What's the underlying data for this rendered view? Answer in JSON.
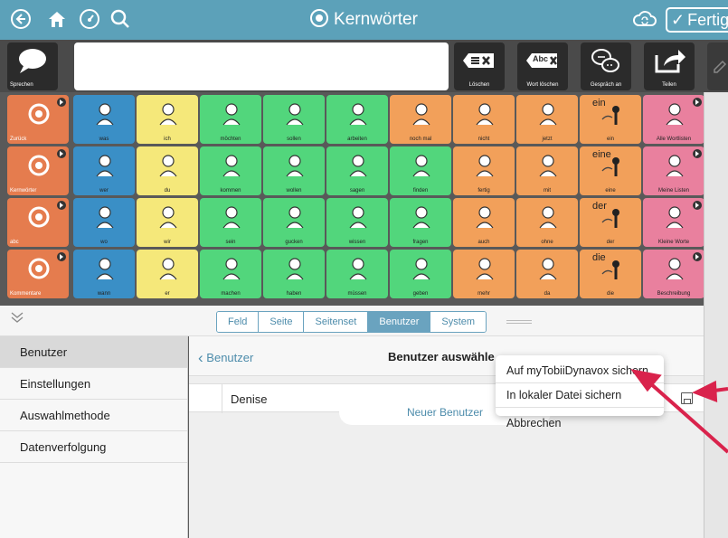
{
  "topbar": {
    "title": "Kernwörter",
    "done_label": "Fertig",
    "icons": [
      "back-circle-icon",
      "home-icon",
      "dashboard-icon",
      "search-icon",
      "cloud-sync-icon"
    ]
  },
  "message_bar": {
    "speak_label": "Sprechen",
    "delete_label": "Löschen",
    "delete_word_label": "Wort löschen",
    "conversation_label": "Gespräch an",
    "share_label": "Teilen",
    "delete_word_icon_text": "Abc",
    "conversation_icon": "speech-bubbles-icon"
  },
  "grid": {
    "cells": [
      {
        "label": "Zurück",
        "color": "#e57c4e",
        "dark": true,
        "icon": "back-arrow-icon"
      },
      {
        "label": "was",
        "color": "#3a8fc6",
        "dark": false,
        "icon": "was-symbol-icon"
      },
      {
        "label": "ich",
        "color": "#f5e87a",
        "dark": false,
        "icon": "ich-symbol-icon"
      },
      {
        "label": "möchten",
        "color": "#52d67c",
        "dark": false,
        "icon": "moechten-symbol-icon"
      },
      {
        "label": "sollen",
        "color": "#52d67c",
        "dark": false,
        "icon": "sollen-symbol-icon"
      },
      {
        "label": "arbeiten",
        "color": "#52d67c",
        "dark": false,
        "icon": "arbeiten-symbol-icon"
      },
      {
        "label": "noch mal",
        "color": "#f2a05a",
        "dark": false,
        "icon": "noch-mal-symbol-icon"
      },
      {
        "label": "nicht",
        "color": "#f2a05a",
        "dark": false,
        "icon": "nicht-symbol-icon"
      },
      {
        "label": "jetzt",
        "color": "#f2a05a",
        "dark": false,
        "icon": "jetzt-symbol-icon"
      },
      {
        "label": "ein",
        "color": "#f2a05a",
        "dark": false,
        "icon": "ein-symbol-icon",
        "word": "ein"
      },
      {
        "label": "Alle Wortlisten",
        "color": "#e9809e",
        "dark": false,
        "icon": "wortlisten-symbol-icon"
      },
      {
        "label": "Kernwörter",
        "color": "#e57c4e",
        "dark": true,
        "icon": "kernwoerter-target-icon"
      },
      {
        "label": "wer",
        "color": "#3a8fc6",
        "dark": false,
        "icon": "wer-symbol-icon"
      },
      {
        "label": "du",
        "color": "#f5e87a",
        "dark": false,
        "icon": "du-symbol-icon"
      },
      {
        "label": "kommen",
        "color": "#52d67c",
        "dark": false,
        "icon": "kommen-symbol-icon"
      },
      {
        "label": "wollen",
        "color": "#52d67c",
        "dark": false,
        "icon": "wollen-symbol-icon"
      },
      {
        "label": "sagen",
        "color": "#52d67c",
        "dark": false,
        "icon": "sagen-symbol-icon"
      },
      {
        "label": "finden",
        "color": "#52d67c",
        "dark": false,
        "icon": "finden-symbol-icon"
      },
      {
        "label": "fertig",
        "color": "#f2a05a",
        "dark": false,
        "icon": "fertig-symbol-icon"
      },
      {
        "label": "mit",
        "color": "#f2a05a",
        "dark": false,
        "icon": "mit-symbol-icon"
      },
      {
        "label": "eine",
        "color": "#f2a05a",
        "dark": false,
        "icon": "eine-symbol-icon",
        "word": "eine"
      },
      {
        "label": "Meine Listen",
        "color": "#e9809e",
        "dark": false,
        "icon": "meine-listen-symbol-icon"
      },
      {
        "label": "abc",
        "color": "#e57c4e",
        "dark": true,
        "icon": "abc-keyboard-icon"
      },
      {
        "label": "wo",
        "color": "#3a8fc6",
        "dark": false,
        "icon": "wo-symbol-icon"
      },
      {
        "label": "wir",
        "color": "#f5e87a",
        "dark": false,
        "icon": "wir-symbol-icon"
      },
      {
        "label": "sein",
        "color": "#52d67c",
        "dark": false,
        "icon": "sein-symbol-icon"
      },
      {
        "label": "gucken",
        "color": "#52d67c",
        "dark": false,
        "icon": "gucken-symbol-icon"
      },
      {
        "label": "wissen",
        "color": "#52d67c",
        "dark": false,
        "icon": "wissen-symbol-icon"
      },
      {
        "label": "fragen",
        "color": "#52d67c",
        "dark": false,
        "icon": "fragen-symbol-icon"
      },
      {
        "label": "auch",
        "color": "#f2a05a",
        "dark": false,
        "icon": "auch-symbol-icon"
      },
      {
        "label": "ohne",
        "color": "#f2a05a",
        "dark": false,
        "icon": "ohne-symbol-icon"
      },
      {
        "label": "der",
        "color": "#f2a05a",
        "dark": false,
        "icon": "der-symbol-icon",
        "word": "der"
      },
      {
        "label": "Kleine Worte",
        "color": "#e9809e",
        "dark": false,
        "icon": "kleine-worte-symbol-icon"
      },
      {
        "label": "Kommentare",
        "color": "#e57c4e",
        "dark": true,
        "icon": "kommentare-flame-icon"
      },
      {
        "label": "wann",
        "color": "#3a8fc6",
        "dark": false,
        "icon": "wann-symbol-icon"
      },
      {
        "label": "er",
        "color": "#f5e87a",
        "dark": false,
        "icon": "er-symbol-icon"
      },
      {
        "label": "machen",
        "color": "#52d67c",
        "dark": false,
        "icon": "machen-symbol-icon"
      },
      {
        "label": "haben",
        "color": "#52d67c",
        "dark": false,
        "icon": "haben-symbol-icon"
      },
      {
        "label": "müssen",
        "color": "#52d67c",
        "dark": false,
        "icon": "muessen-symbol-icon"
      },
      {
        "label": "geben",
        "color": "#52d67c",
        "dark": false,
        "icon": "geben-symbol-icon"
      },
      {
        "label": "mehr",
        "color": "#f2a05a",
        "dark": false,
        "icon": "mehr-symbol-icon"
      },
      {
        "label": "da",
        "color": "#f2a05a",
        "dark": false,
        "icon": "da-symbol-icon"
      },
      {
        "label": "die",
        "color": "#f2a05a",
        "dark": false,
        "icon": "die-symbol-icon",
        "word": "die"
      },
      {
        "label": "Beschreibung",
        "color": "#e9809e",
        "dark": false,
        "icon": "beschreibung-symbol-icon"
      }
    ]
  },
  "tabs": {
    "items": [
      "Feld",
      "Seite",
      "Seitenset",
      "Benutzer",
      "System"
    ],
    "active_index": 3
  },
  "sidebar": {
    "items": [
      {
        "label": "Benutzer",
        "active": true
      },
      {
        "label": "Einstellungen",
        "active": false
      },
      {
        "label": "Auswahlmethode",
        "active": false
      },
      {
        "label": "Datenverfolgung",
        "active": false
      }
    ]
  },
  "panel": {
    "back_label": "Benutzer",
    "title": "Benutzer auswähle",
    "user_name": "Denise",
    "new_user_label": "Neuer Benutzer"
  },
  "popup": {
    "items": [
      "Auf myTobiiDynavox sichern",
      "In lokaler Datei sichern",
      "Abbrechen"
    ]
  },
  "colors": {
    "topbar": "#5ca1b9",
    "accent": "#4d8cab",
    "annotation_arrow": "#d9234c"
  }
}
